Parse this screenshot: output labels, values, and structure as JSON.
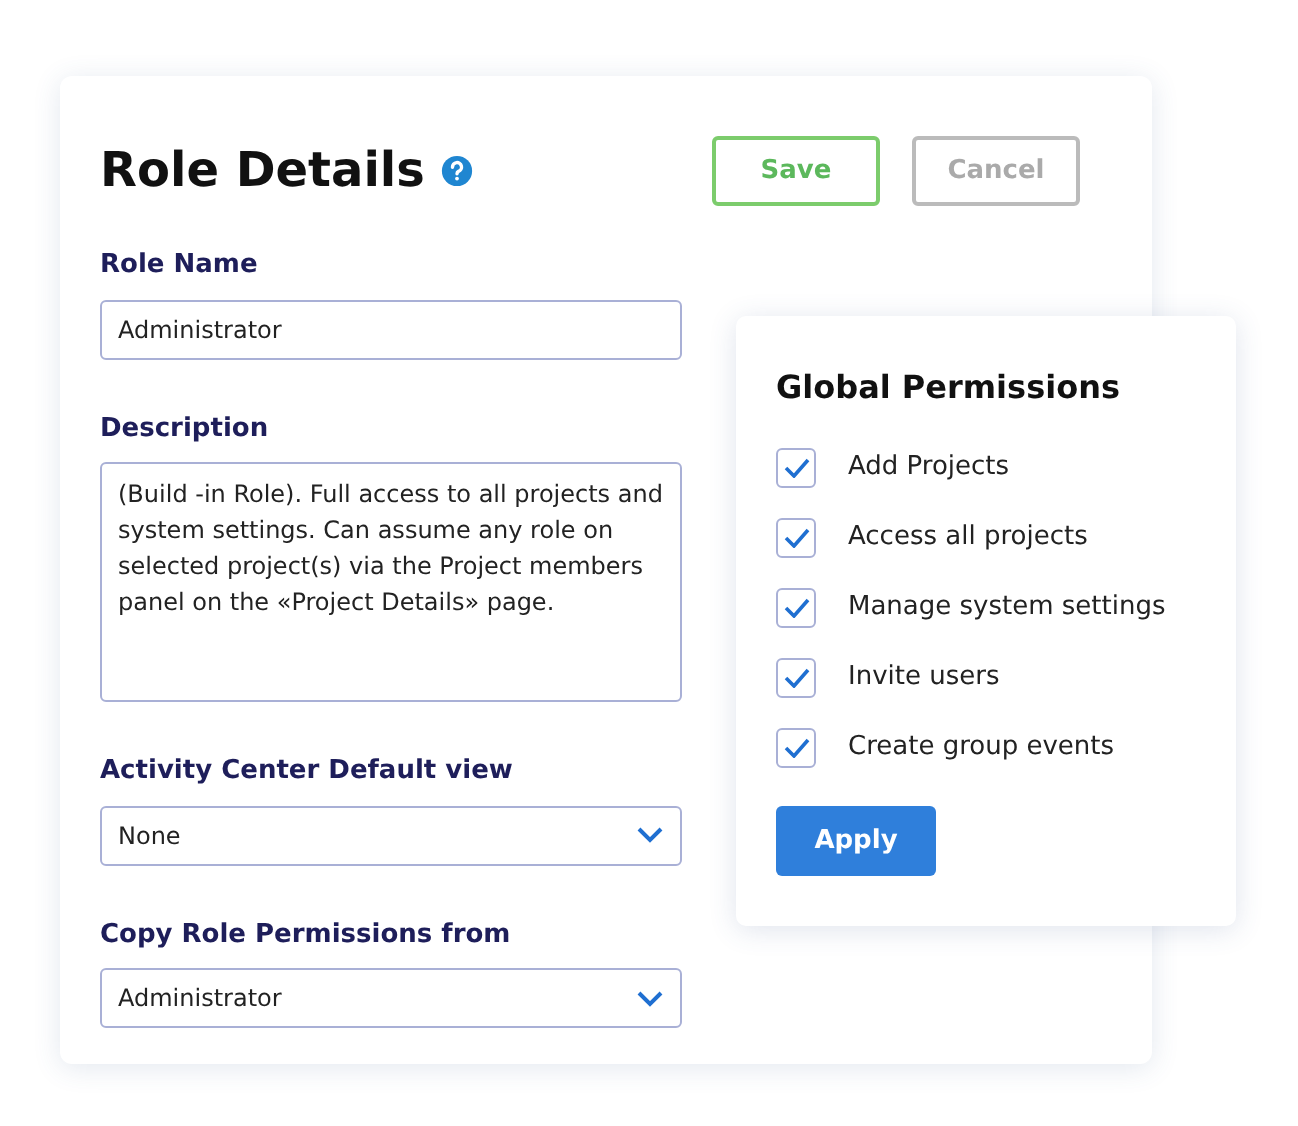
{
  "title": "Role Details",
  "buttons": [
    {
      "label": "Save",
      "kind": "save"
    },
    {
      "label": "Cancel",
      "kind": "cancel"
    }
  ],
  "fields": [
    {
      "label": "Role Name",
      "kind": "input",
      "value": "Administrator"
    },
    {
      "label": "Description",
      "kind": "textarea",
      "value": "(Build -in Role). Full access to all projects and system settings. Can assume any role on selected project(s) via the Project members panel on the «Project Details» page."
    },
    {
      "label": "Activity Center Default view",
      "kind": "select",
      "value": "None"
    },
    {
      "label": "Copy Role Permissions from",
      "kind": "select",
      "value": "Administrator"
    }
  ],
  "permissions": {
    "title": "Global Permissions",
    "items": [
      {
        "label": "Add Projects",
        "checked": true
      },
      {
        "label": "Access all projects",
        "checked": true
      },
      {
        "label": "Manage system settings",
        "checked": true
      },
      {
        "label": "Invite users",
        "checked": true
      },
      {
        "label": "Create group events",
        "checked": true
      }
    ],
    "button": "Apply"
  }
}
